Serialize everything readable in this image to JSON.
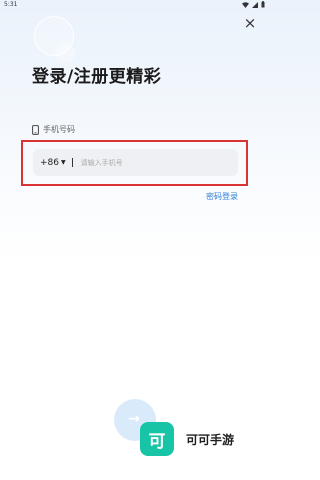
{
  "status_bar": {
    "time": "5:31"
  },
  "header": {
    "close_icon": "×",
    "title": "登录/注册更精彩"
  },
  "form": {
    "phone_label": "手机号码",
    "country_code": "+86",
    "country_caret": "▼",
    "phone_placeholder": "请输入手机号",
    "phone_value": "",
    "password_login_link": "密码登录"
  },
  "footer": {
    "arrow_glyph": "→",
    "logo_char": "可",
    "brand_name": "可可手游"
  },
  "colors": {
    "accent": "#2f7ed8",
    "brand": "#18c4a6",
    "highlight_border": "#d93333"
  }
}
